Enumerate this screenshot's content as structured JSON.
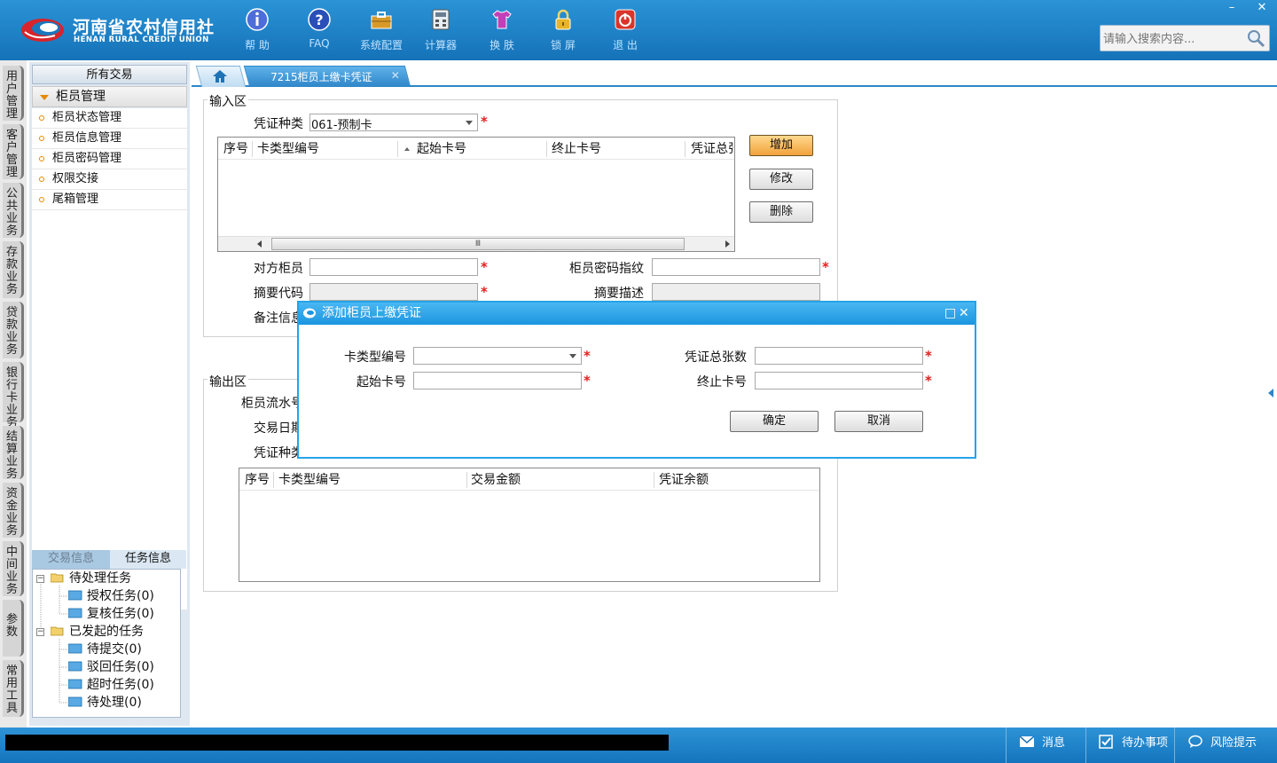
{
  "brand": {
    "name_cn": "河南省农村信用社",
    "name_en": "HENAN RURAL CREDIT UNION"
  },
  "toolbar": {
    "items": [
      {
        "label": "帮 助",
        "icon": "info-icon"
      },
      {
        "label": "FAQ",
        "icon": "question-icon"
      },
      {
        "label": "系统配置",
        "icon": "toolbox-icon"
      },
      {
        "label": "计算器",
        "icon": "calculator-icon"
      },
      {
        "label": "换 肤",
        "icon": "shirt-icon"
      },
      {
        "label": "锁 屏",
        "icon": "lock-icon"
      },
      {
        "label": "退 出",
        "icon": "power-icon"
      }
    ],
    "minimize_glyph": "–",
    "close_glyph": "✕"
  },
  "search": {
    "placeholder": "请输入搜索内容..."
  },
  "side_tabs": [
    "用户管理",
    "客户管理",
    "公共业务",
    "存款业务",
    "贷款业务",
    "银行卡业务",
    "结算业务",
    "资金业务",
    "中间业务",
    "参数",
    "常用工具"
  ],
  "menu": {
    "header": "所有交易",
    "group": "柜员管理",
    "items": [
      "柜员状态管理",
      "柜员信息管理",
      "柜员密码管理",
      "权限交接",
      "尾箱管理"
    ]
  },
  "info_tabs": {
    "transaction": "交易信息",
    "task": "任务信息"
  },
  "tasks": {
    "pending": "待处理任务",
    "auth": "授权任务(0)",
    "review": "复核任务(0)",
    "initiated": "已发起的任务",
    "to_submit": "待提交(0)",
    "rejected": "驳回任务(0)",
    "timeout": "超时任务(0)",
    "to_process": "待处理(0)"
  },
  "tabs": {
    "active": "7215柜员上缴卡凭证",
    "close_glyph": "✕"
  },
  "input_area": {
    "title": "输入区",
    "voucher_type_label": "凭证种类",
    "voucher_type_value": "061-预制卡",
    "grid_headers": [
      "序号",
      "卡类型编号",
      "起始卡号",
      "终止卡号",
      "凭证总张"
    ],
    "add_button": "增加",
    "edit_button": "修改",
    "delete_button": "删除",
    "counterpart_teller_label": "对方柜员",
    "teller_fingerprint_label": "柜员密码指纹",
    "summary_code_label": "摘要代码",
    "summary_desc_label": "摘要描述",
    "remark_label": "备注信息",
    "scroll_thumb_glyph": "Ⅲ"
  },
  "output_area": {
    "title": "输出区",
    "teller_serial_label": "柜员流水号",
    "trade_date_label": "交易日期",
    "voucher_type_label": "凭证种类",
    "grid_headers": [
      "序号",
      "卡类型编号",
      "交易金额",
      "凭证余额"
    ]
  },
  "dialog": {
    "title": "添加柜员上缴凭证",
    "card_type_label": "卡类型编号",
    "voucher_total_label": "凭证总张数",
    "start_card_label": "起始卡号",
    "end_card_label": "终止卡号",
    "ok_button": "确定",
    "cancel_button": "取消",
    "maximize_glyph": "□",
    "close_glyph": "✕"
  },
  "statusbar": {
    "message": "消息",
    "todo": "待办事项",
    "risk": "风险提示"
  },
  "required_mark": "*",
  "colors": {
    "titlebar_blue": "#1c87cf",
    "required_red": "#e02020",
    "add_button_orange": "#f1a23a",
    "dialog_border": "#25a3e8"
  }
}
